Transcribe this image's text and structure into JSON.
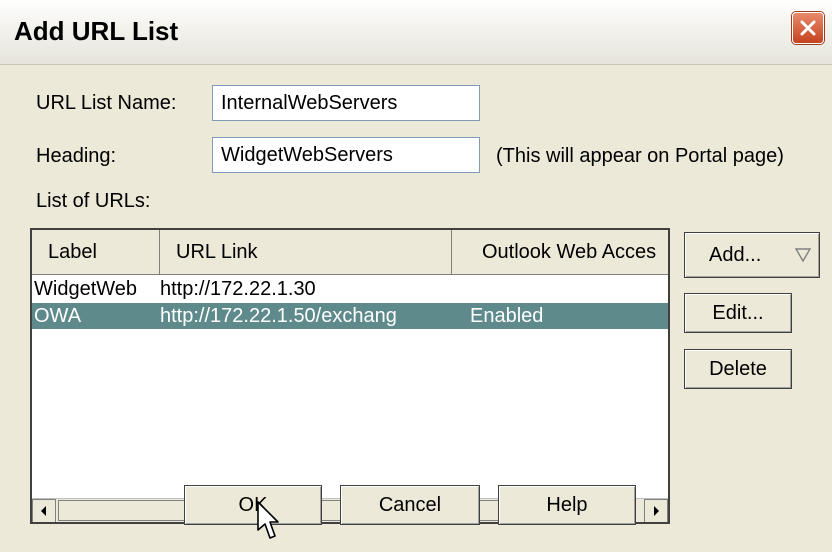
{
  "window": {
    "title": "Add URL List"
  },
  "form": {
    "url_list_name_label": "URL List Name:",
    "url_list_name_value": "InternalWebServers",
    "heading_label": "Heading:",
    "heading_value": "WidgetWebServers",
    "heading_note": "(This will appear on Portal page)",
    "list_label": "List of URLs:"
  },
  "table": {
    "columns": [
      "Label",
      "URL Link",
      "Outlook Web Acces"
    ],
    "rows": [
      {
        "label": "WidgetWeb",
        "url": "http://172.22.1.30",
        "owa": "",
        "selected": false
      },
      {
        "label": "OWA",
        "url": "http://172.22.1.50/exchang",
        "owa": "Enabled",
        "selected": true
      }
    ]
  },
  "side_buttons": {
    "add": "Add...",
    "edit": "Edit...",
    "delete": "Delete"
  },
  "footer_buttons": {
    "ok": "OK",
    "cancel": "Cancel",
    "help": "Help"
  },
  "icons": {
    "close": "close-icon",
    "dropdown": "triangle-down-icon",
    "cursor": "mouse-pointer-icon"
  }
}
